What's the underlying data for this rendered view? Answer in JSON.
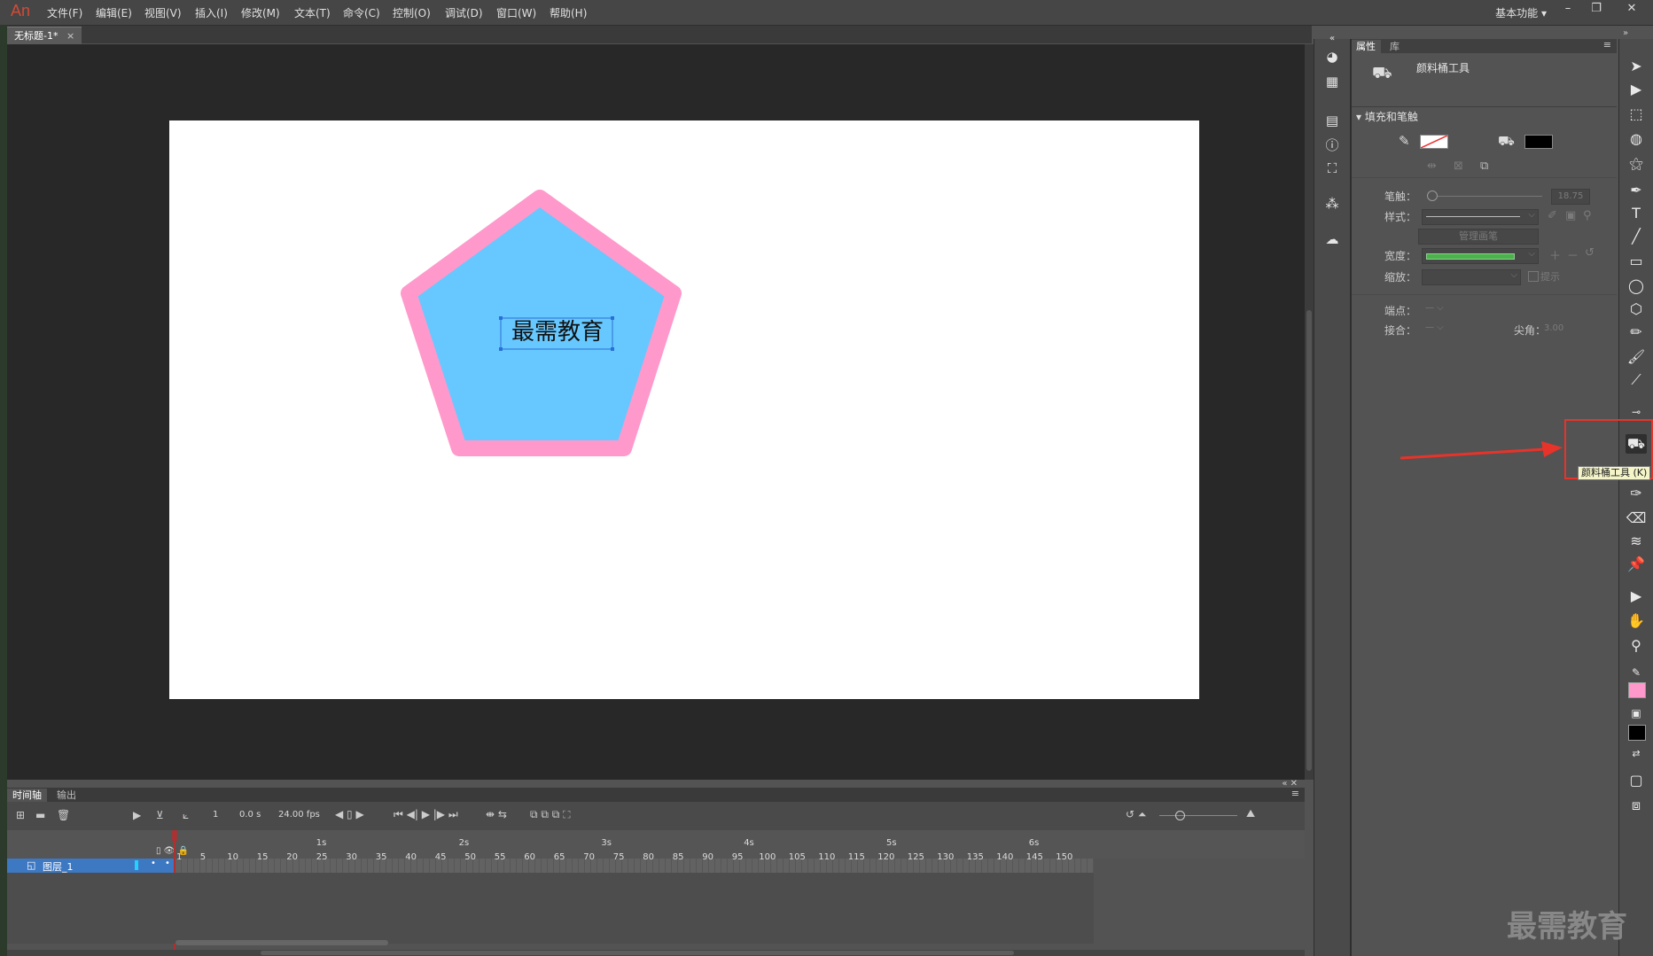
{
  "app": {
    "logo": "An"
  },
  "menu": [
    "文件(F)",
    "编辑(E)",
    "视图(V)",
    "插入(I)",
    "修改(M)",
    "文本(T)",
    "命令(C)",
    "控制(O)",
    "调试(D)",
    "窗口(W)",
    "帮助(H)"
  ],
  "workspace": "基本功能",
  "document_tab": {
    "title": "无标题-1*",
    "close": "×"
  },
  "stage": {
    "text": "最需教育",
    "pentagon_fill": "#66C8FF",
    "pentagon_stroke": "#FF99CC"
  },
  "properties": {
    "tabs": [
      "属性",
      "库"
    ],
    "tool_name": "颜料桶工具",
    "section": "填充和笔触",
    "stroke_label": "笔触：",
    "stroke_value": "18.75",
    "style_label": "样式：",
    "manage_brush": "管理画笔",
    "width_label": "宽度：",
    "scale_label": "缩放：",
    "hint_label": "提示",
    "cap_label": "端点：",
    "join_label": "接合：",
    "miter_label": "尖角：",
    "miter_value": "3.00",
    "fill_color": "#000000"
  },
  "toolbar": {
    "tooltip": "颜料桶工具 (K)",
    "stroke_swatch": "#FF99CC",
    "fill_swatch": "#000000"
  },
  "timeline": {
    "tabs": [
      "时间轴",
      "输出"
    ],
    "frame": "1",
    "time": "0.0 s",
    "fps": "24.00 fps",
    "layer_name": "图层_1",
    "seconds": [
      "1s",
      "2s",
      "3s",
      "4s",
      "5s",
      "6s"
    ],
    "ruler": [
      "1",
      "5",
      "10",
      "15",
      "20",
      "25",
      "30",
      "35",
      "40",
      "45",
      "50",
      "55",
      "60",
      "65",
      "70",
      "75",
      "80",
      "85",
      "90",
      "95",
      "100",
      "105",
      "110",
      "115",
      "120",
      "125",
      "130",
      "135",
      "140",
      "145",
      "150"
    ]
  },
  "watermark": "最需教育"
}
